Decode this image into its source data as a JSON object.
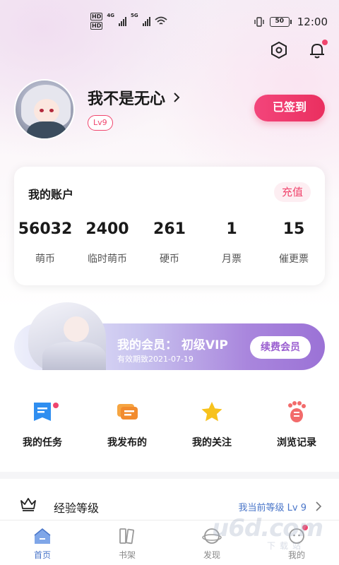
{
  "status_bar": {
    "hd1": "HD",
    "hd2": "HD",
    "net1": "4G",
    "net2": "5G",
    "battery": "50",
    "time": "12:00"
  },
  "header": {
    "settings_icon": "settings-hex-icon",
    "notification_icon": "bell-icon",
    "notification_has_dot": true
  },
  "profile": {
    "nickname": "我不是无心",
    "level_badge": "Lv9",
    "checkin_label": "已签到"
  },
  "account": {
    "title": "我的账户",
    "recharge_label": "充值",
    "stats": [
      {
        "value": "56032",
        "label": "萌币"
      },
      {
        "value": "2400",
        "label": "临时萌币"
      },
      {
        "value": "261",
        "label": "硬币"
      },
      {
        "value": "1",
        "label": "月票"
      },
      {
        "value": "15",
        "label": "催更票"
      }
    ]
  },
  "vip": {
    "title": "我的会员： 初级VIP",
    "expiry": "有效期致2021-07-19",
    "renew_label": "续费会员"
  },
  "quick_menu": [
    {
      "label": "我的任务",
      "icon": "task-icon",
      "has_dot": true
    },
    {
      "label": "我发布的",
      "icon": "message-icon",
      "has_dot": false
    },
    {
      "label": "我的关注",
      "icon": "star-icon",
      "has_dot": false
    },
    {
      "label": "浏览记录",
      "icon": "footprint-icon",
      "has_dot": false
    }
  ],
  "level": {
    "label": "经验等级",
    "current": "我当前等级 Lv 9",
    "icon": "crown-icon"
  },
  "tabs": [
    {
      "label": "首页",
      "icon": "home-icon",
      "active": true
    },
    {
      "label": "书架",
      "icon": "bookshelf-icon",
      "active": false
    },
    {
      "label": "发现",
      "icon": "discover-icon",
      "active": false
    },
    {
      "label": "我的",
      "icon": "profile-icon",
      "active": false
    }
  ],
  "watermark": {
    "text": "u6d.com",
    "sub": "下载站"
  },
  "colors": {
    "accent_pink": "#f0456d",
    "accent_blue": "#4a76c9",
    "vip_purple": "#9b72d6"
  }
}
